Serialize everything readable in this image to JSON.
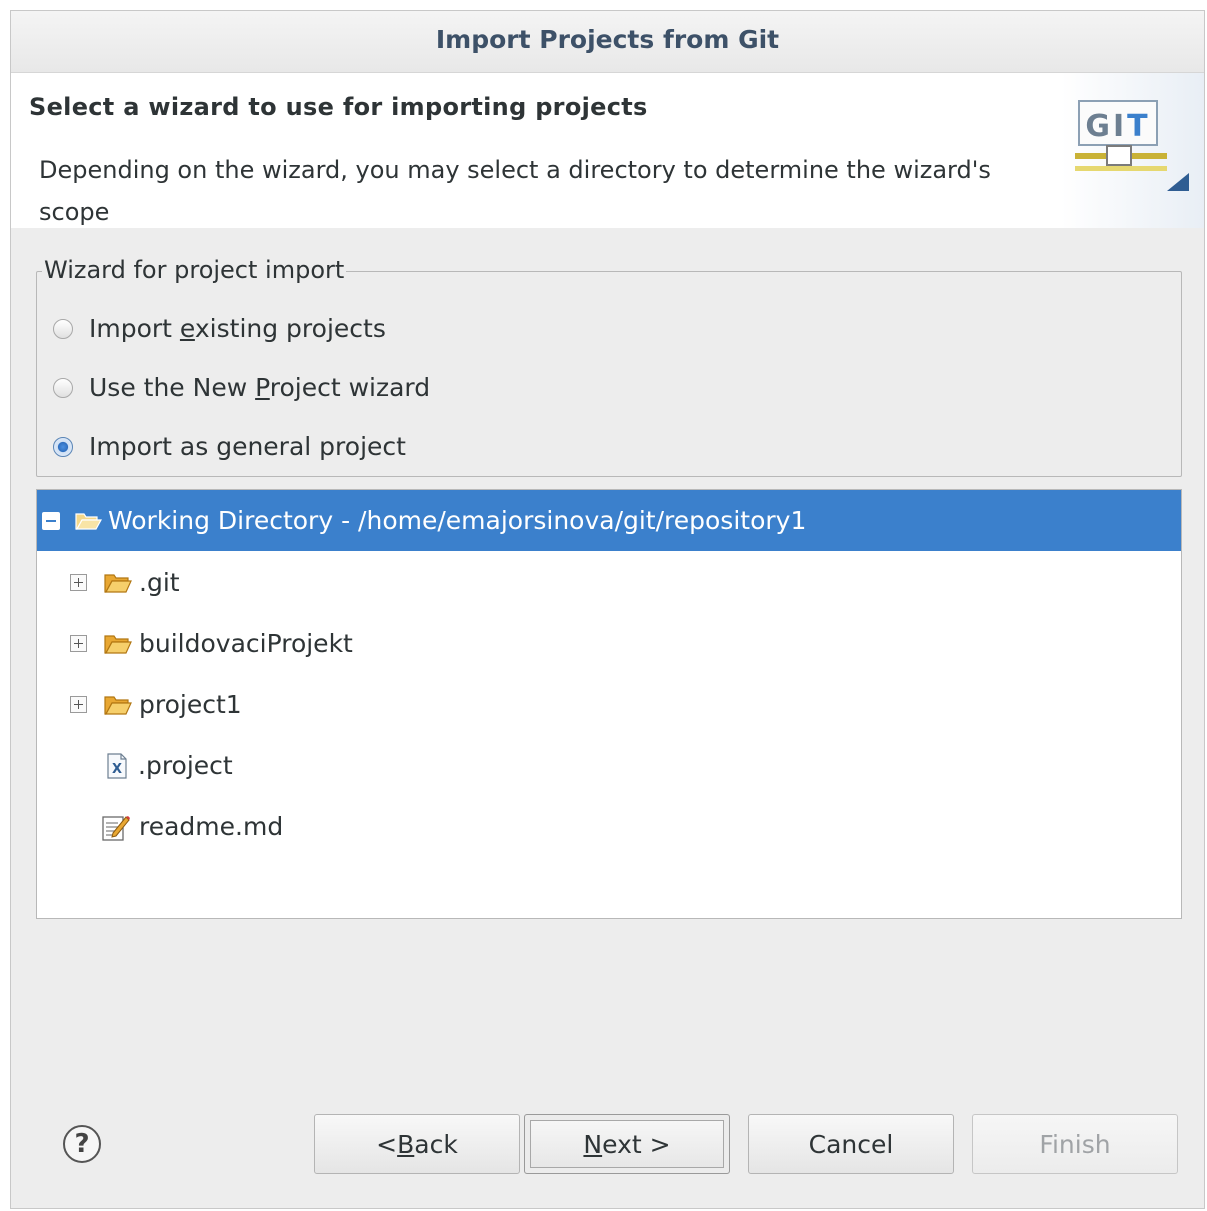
{
  "window": {
    "title": "Import Projects from Git"
  },
  "banner": {
    "heading": "Select a wizard to use for importing projects",
    "description": "Depending on the wizard, you may select a directory to determine the wizard's scope",
    "logo_text": "GIT"
  },
  "wizard_group": {
    "legend": "Wizard for project import",
    "options": [
      {
        "pre": "Import ",
        "mnemonic": "e",
        "post": "xisting projects",
        "checked": false
      },
      {
        "pre": "Use the New ",
        "mnemonic": "P",
        "post": "roject wizard",
        "checked": false
      },
      {
        "pre": "Import as general project",
        "mnemonic": "",
        "post": "",
        "checked": true
      }
    ]
  },
  "tree": {
    "root": {
      "label": "Working Directory - /home/emajorsinova/git/repository1",
      "icon": "folder-open-icon",
      "expanded": true,
      "selected": true
    },
    "children": [
      {
        "label": ".git",
        "icon": "folder-icon",
        "expandable": true
      },
      {
        "label": "buildovaciProjekt",
        "icon": "folder-icon",
        "expandable": true
      },
      {
        "label": "project1",
        "icon": "folder-icon",
        "expandable": true
      },
      {
        "label": ".project",
        "icon": "xml-file-icon",
        "expandable": false
      },
      {
        "label": "readme.md",
        "icon": "text-file-icon",
        "expandable": false
      }
    ]
  },
  "buttons": {
    "back": {
      "pre": "< ",
      "mnemonic": "B",
      "post": "ack"
    },
    "next": {
      "pre": "",
      "mnemonic": "N",
      "post": "ext >"
    },
    "cancel": {
      "label": "Cancel"
    },
    "finish": {
      "label": "Finish",
      "enabled": false
    }
  },
  "colors": {
    "selection": "#3b80cc",
    "title_text": "#3d5168",
    "dialog_bg": "#ededed"
  }
}
